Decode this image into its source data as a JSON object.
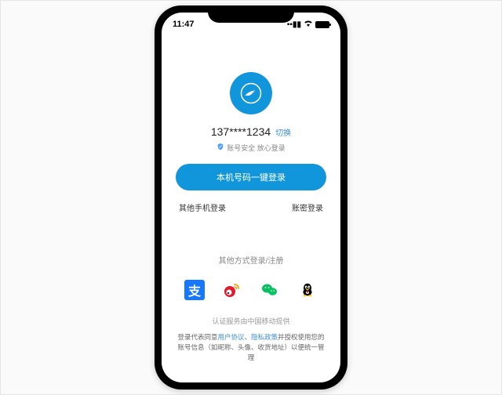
{
  "status": {
    "time": "11:47"
  },
  "login": {
    "phone_number": "137****1234",
    "switch_label": "切换",
    "security_note": "账号安全 放心登录",
    "primary_button": "本机号码一键登录",
    "other_phone": "其他手机登录",
    "account_login": "账密登录"
  },
  "social": {
    "title": "其他方式登录/注册",
    "alipay_glyph": "支",
    "icons": {
      "alipay": "alipay-icon",
      "weibo": "weibo-icon",
      "wechat": "wechat-icon",
      "qq": "qq-icon"
    }
  },
  "footer": {
    "provider": "认证服务由中国移动提供",
    "agreement_prefix": "登录代表同意",
    "user_agreement": "用户协议",
    "sep1": "、",
    "privacy_policy": "隐私政策",
    "agreement_mid": "并授权使用您的账号信息（如昵称、头像、收货地址）以便统一管理"
  },
  "colors": {
    "primary": "#1296db",
    "link": "#3b8ede"
  }
}
